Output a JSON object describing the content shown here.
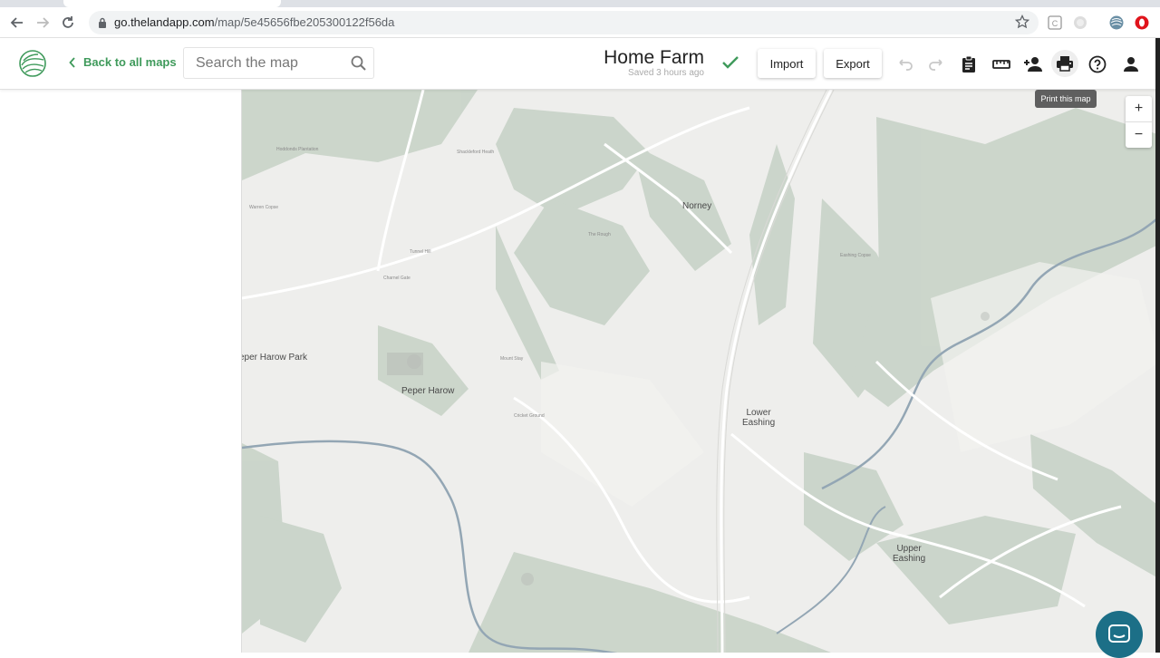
{
  "browser": {
    "url_host": "go.thelandapp.com",
    "url_path": "/map/5e45656fbe205300122f56da"
  },
  "header": {
    "back_label": "Back to all maps",
    "search_placeholder": "Search the map",
    "map_name": "Home Farm",
    "saved_status": "Saved 3 hours ago",
    "import_label": "Import",
    "export_label": "Export",
    "tooltip": "Print this map"
  },
  "map": {
    "zoom_in": "+",
    "zoom_out": "−",
    "places": {
      "norney": "Norney",
      "peper_harow_park": "eper Harow Park",
      "peper_harow": "Peper Harow",
      "lower_eashing_1": "Lower",
      "lower_eashing_2": "Eashing",
      "upper_eashing_1": "Upper",
      "upper_eashing_2": "Eashing"
    },
    "small_labels": {
      "shackleford_heath": "Shackleford Heath",
      "the_rough": "The Rough",
      "eashing_copse": "Eashing Copse",
      "tunnel_hill": "Tunnel Hill",
      "charnel_gate": "Charnel Gate",
      "mount_stay": "Mount Stay",
      "cricket_ground": "Cricket Ground",
      "hoddonds_plantation": "Hoddonds Plantation",
      "warren_copse": "Warren Copse"
    }
  },
  "colors": {
    "brand_green": "#3f9a5b",
    "map_bg": "#eeeeec",
    "woodland": "#c8d3c8",
    "water": "#93a6b4",
    "chat": "#1c6f87"
  }
}
